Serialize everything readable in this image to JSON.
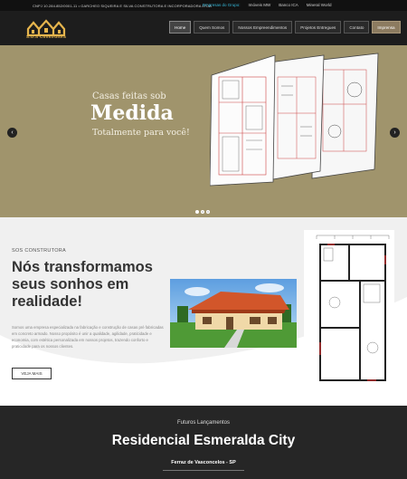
{
  "topbar": {
    "company_line": "CNPJ 10.284.852/0001-11 • GARCHEO SIQUEIRA E SILVA CONSTRUTORA E INCORPORADORA LTDA",
    "group_label": "Empresas do Grupo:",
    "group_links": [
      "Imóveis MW",
      "Banco ICA",
      "Mineral World"
    ]
  },
  "header": {
    "logo_text": "S.O.S Construtora",
    "nav": [
      "Home",
      "Quem Somos",
      "Nossos Empreendimentos",
      "Projetos Entregues",
      "Contato",
      "Imprensa"
    ],
    "active_nav": "Home",
    "highlight_nav": "Imprensa"
  },
  "hero": {
    "line1": "Casas feitas sob",
    "line2": "Medida",
    "line3": "Totalmente para você!",
    "prev_label": "‹",
    "next_label": "›",
    "slide_count": 3,
    "active_slide": 1
  },
  "about": {
    "kicker": "SOS CONSTRUTORA",
    "headline": "Nós transformamos seus sonhos em realidade!",
    "paragraph": "Somos uma empresa especializada na fabricação e construção de casas pré fabricadas em concreto armado. Nosso propósito é unir a qualidade, agilidade, praticidade e economia, com estética personalizada em nossos projetos, trazendo conforto e praticidade para os nossos clientes.",
    "button_label": "VEJA MAIS"
  },
  "launch": {
    "subtitle": "Futuros Lançamentos",
    "title": "Residencial Esmeralda City",
    "location": "Ferraz de Vasconcelos - SP"
  },
  "colors": {
    "hero_bg": "#a0946c",
    "logo_gold": "#e6b54d",
    "topbar_link": "#34b7d8",
    "dark": "#1d1d1d"
  }
}
